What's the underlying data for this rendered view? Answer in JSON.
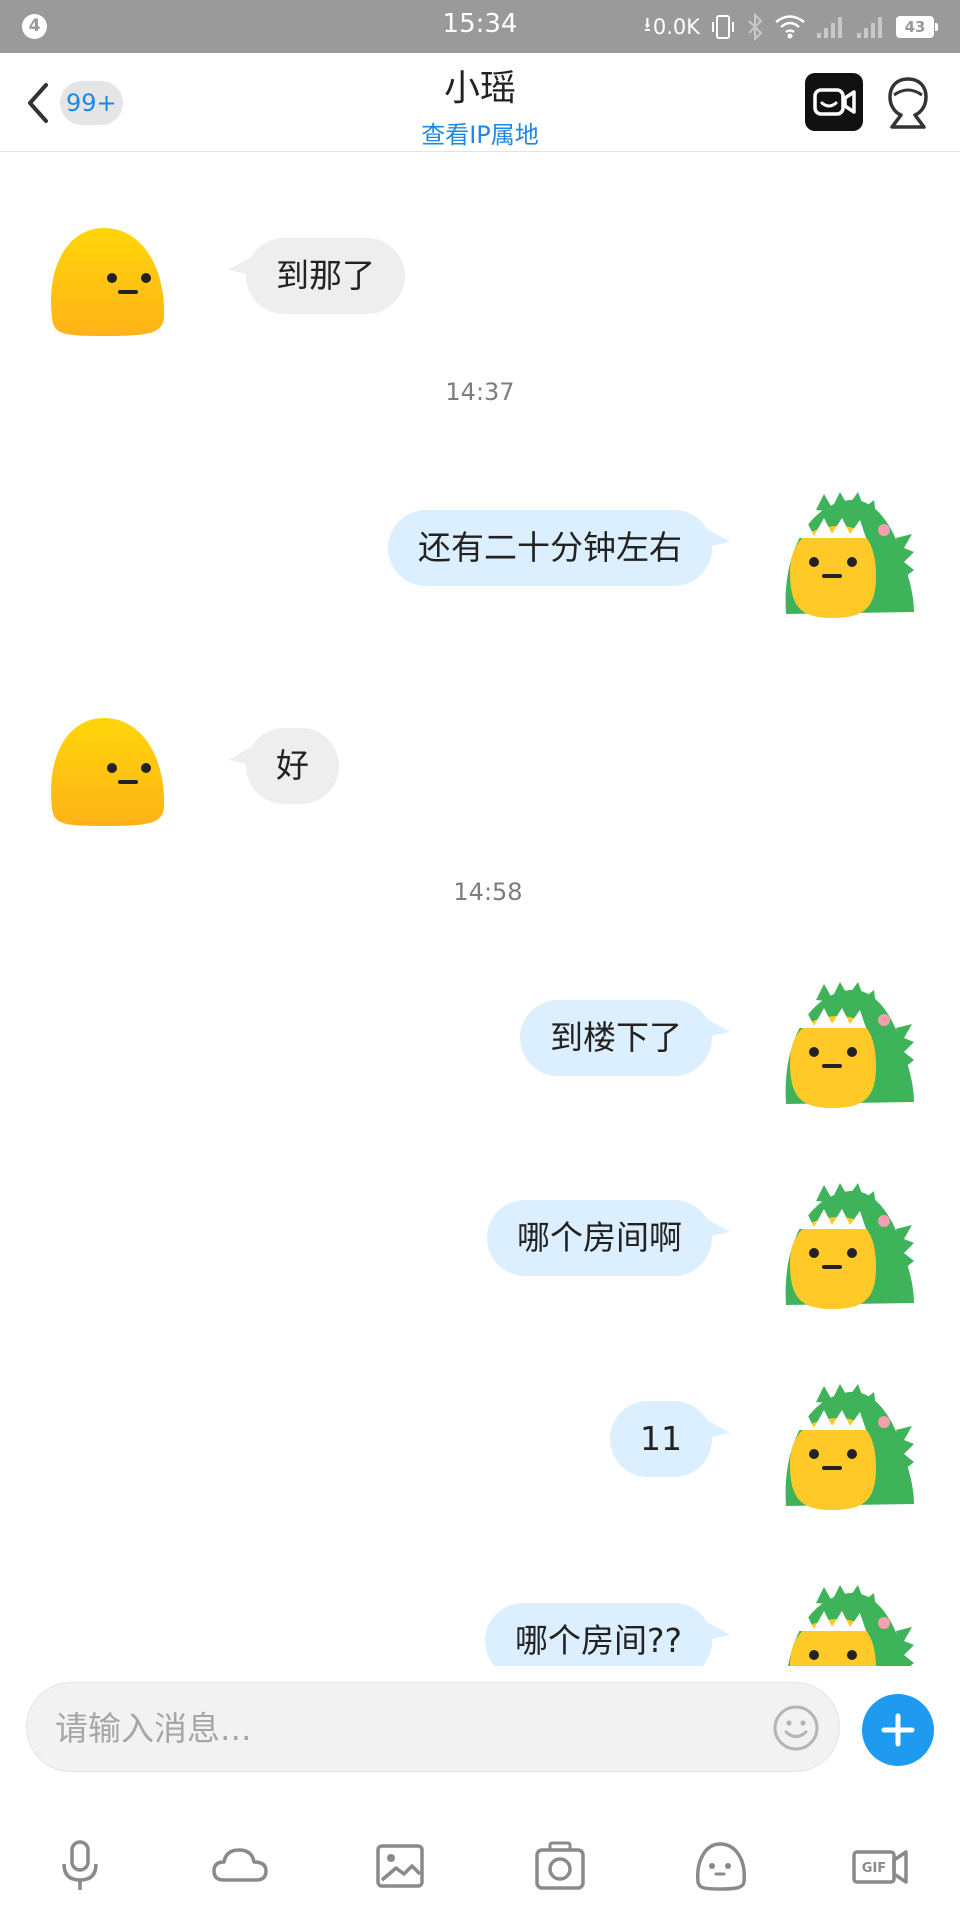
{
  "status_bar": {
    "notification_count": "4",
    "time": "15:34",
    "net_speed": "0.0K",
    "battery": "43"
  },
  "header": {
    "back_badge": "99+",
    "contact_name": "小瑶",
    "ip_link": "查看IP属地"
  },
  "messages": [
    {
      "side": "in",
      "text": "到那了"
    },
    {
      "type": "time",
      "text": "14:37"
    },
    {
      "side": "out",
      "text": "还有二十分钟左右"
    },
    {
      "side": "in",
      "text": "好"
    },
    {
      "type": "time",
      "text": "14:58"
    },
    {
      "side": "out",
      "text": "到楼下了"
    },
    {
      "side": "out",
      "text": "哪个房间啊"
    },
    {
      "side": "out",
      "text": "11"
    },
    {
      "side": "out",
      "text": "哪个房间??"
    }
  ],
  "input": {
    "placeholder": "请输入消息..."
  },
  "toolbar": [
    {
      "icon": "microphone-icon"
    },
    {
      "icon": "cloud-icon"
    },
    {
      "icon": "image-icon"
    },
    {
      "icon": "camera-icon"
    },
    {
      "icon": "sticker-icon"
    },
    {
      "icon": "gif-icon"
    }
  ],
  "colors": {
    "accent": "#1e88e5",
    "outgoing_bubble": "#dcefff",
    "incoming_bubble": "#eeeeee",
    "status_bar": "#9a9a9a",
    "plus_button": "#1e9bf0"
  }
}
